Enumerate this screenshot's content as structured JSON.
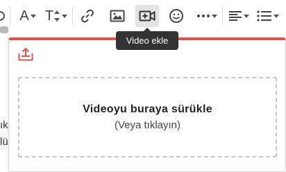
{
  "toolbar": {
    "buttons": [
      {
        "name": "more-left-icon"
      },
      {
        "name": "font-color-icon",
        "label": "A"
      },
      {
        "name": "font-size-icon",
        "label": "T"
      },
      {
        "name": "link-icon"
      },
      {
        "name": "image-icon"
      },
      {
        "name": "video-icon"
      },
      {
        "name": "emoji-icon"
      },
      {
        "name": "more-options-icon"
      },
      {
        "name": "align-icon"
      },
      {
        "name": "list-icon"
      }
    ]
  },
  "tooltip": {
    "text": "Video ekle"
  },
  "popup": {
    "upload_icon": "upload-icon",
    "dropzone": {
      "title": "Videoyu buraya sürükle",
      "subtitle": "(Veya tıklayın)"
    },
    "accent_color": "#d9534f"
  },
  "background": {
    "fragment_1": "ık",
    "fragment_2": "lü"
  }
}
